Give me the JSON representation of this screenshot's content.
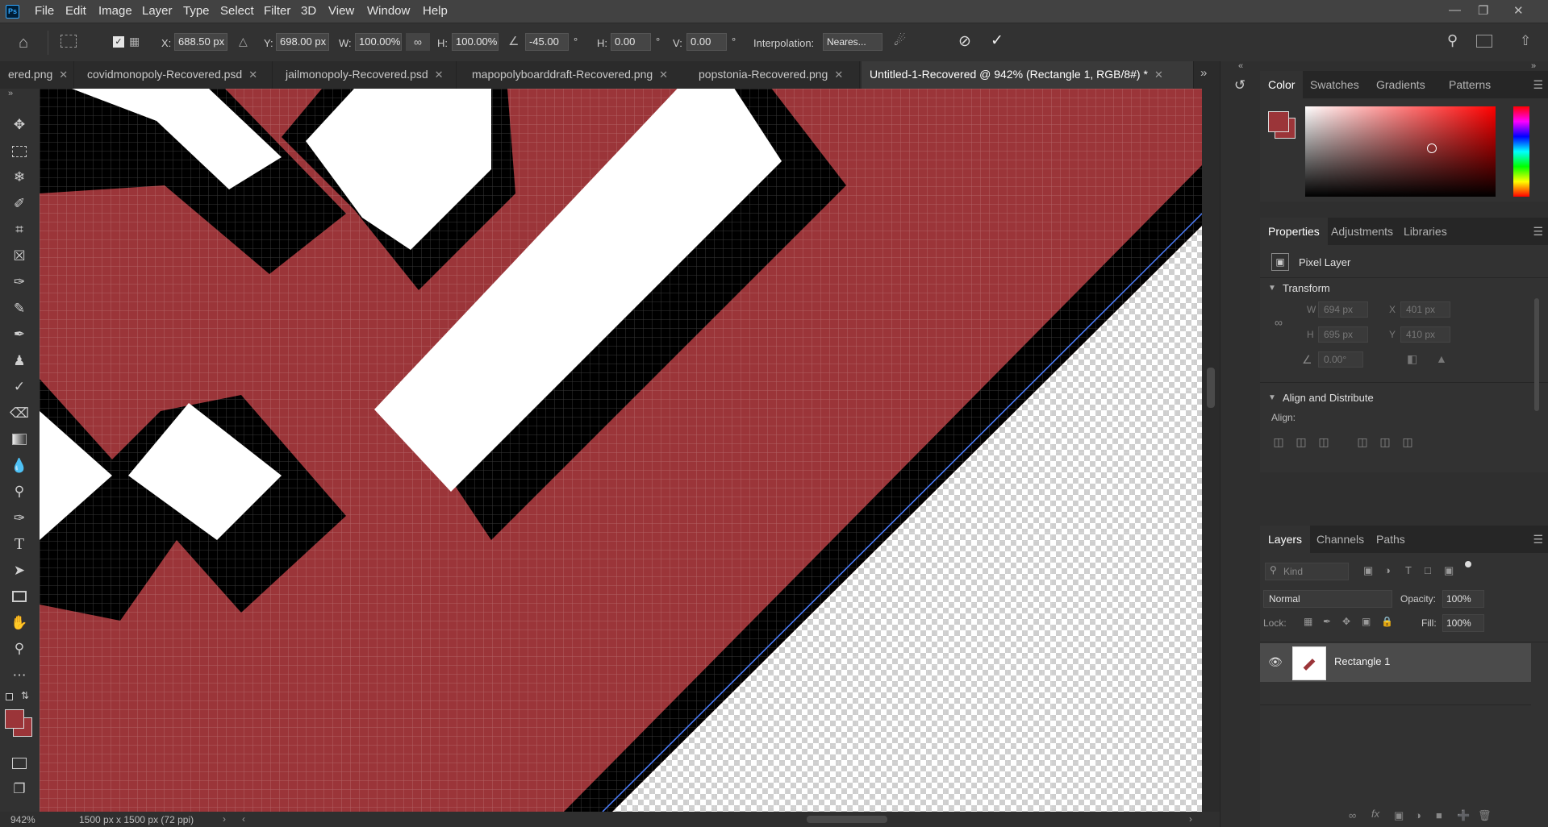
{
  "app": {
    "logo": "Ps"
  },
  "menubar": {
    "items": [
      "File",
      "Edit",
      "Image",
      "Layer",
      "Type",
      "Select",
      "Filter",
      "3D",
      "View",
      "Window",
      "Help"
    ]
  },
  "options": {
    "x_label": "X:",
    "x_value": "688.50 px",
    "y_label": "Y:",
    "y_value": "698.00 px",
    "w_label": "W:",
    "w_value": "100.00%",
    "h_label": "H:",
    "h_value": "100.00%",
    "angle_value": "-45.00",
    "angle_unit": "°",
    "hskew_label": "H:",
    "hskew_value": "0.00",
    "hskew_unit": "°",
    "vskew_label": "V:",
    "vskew_value": "0.00",
    "vskew_unit": "°",
    "interp_label": "Interpolation:",
    "interp_value": "Neares..."
  },
  "tabs": [
    {
      "label": "ered.png"
    },
    {
      "label": "covidmonopoly-Recovered.psd"
    },
    {
      "label": "jailmonopoly-Recovered.psd"
    },
    {
      "label": "mapopolyboarddraft-Recovered.png"
    },
    {
      "label": "popstonia-Recovered.png"
    },
    {
      "label": "Untitled-1-Recovered @ 942% (Rectangle 1, RGB/8#) *"
    }
  ],
  "status": {
    "zoom": "942%",
    "doc_info": "1500 px x 1500 px (72 ppi)"
  },
  "color_panel": {
    "tabs": [
      "Color",
      "Swatches",
      "Gradients",
      "Patterns"
    ],
    "fg_color": "#9b3539",
    "bg_color": "#9b3539"
  },
  "properties_panel": {
    "tabs": [
      "Properties",
      "Adjustments",
      "Libraries"
    ],
    "kind": "Pixel Layer",
    "transform_title": "Transform",
    "w_label": "W",
    "w_value": "694 px",
    "x_label": "X",
    "x_value": "401 px",
    "h_label": "H",
    "h_value": "695 px",
    "y_label": "Y",
    "y_value": "410 px",
    "angle_value": "0.00°",
    "align_title": "Align and Distribute",
    "align_label": "Align:"
  },
  "layers_panel": {
    "tabs": [
      "Layers",
      "Channels",
      "Paths"
    ],
    "kind_placeholder": "Kind",
    "blend_mode": "Normal",
    "opacity_label": "Opacity:",
    "opacity_value": "100%",
    "lock_label": "Lock:",
    "fill_label": "Fill:",
    "fill_value": "100%",
    "layer_name": "Rectangle 1"
  },
  "colors": {
    "canvas_red": "#9b3539",
    "accent": "#31a8ff"
  }
}
